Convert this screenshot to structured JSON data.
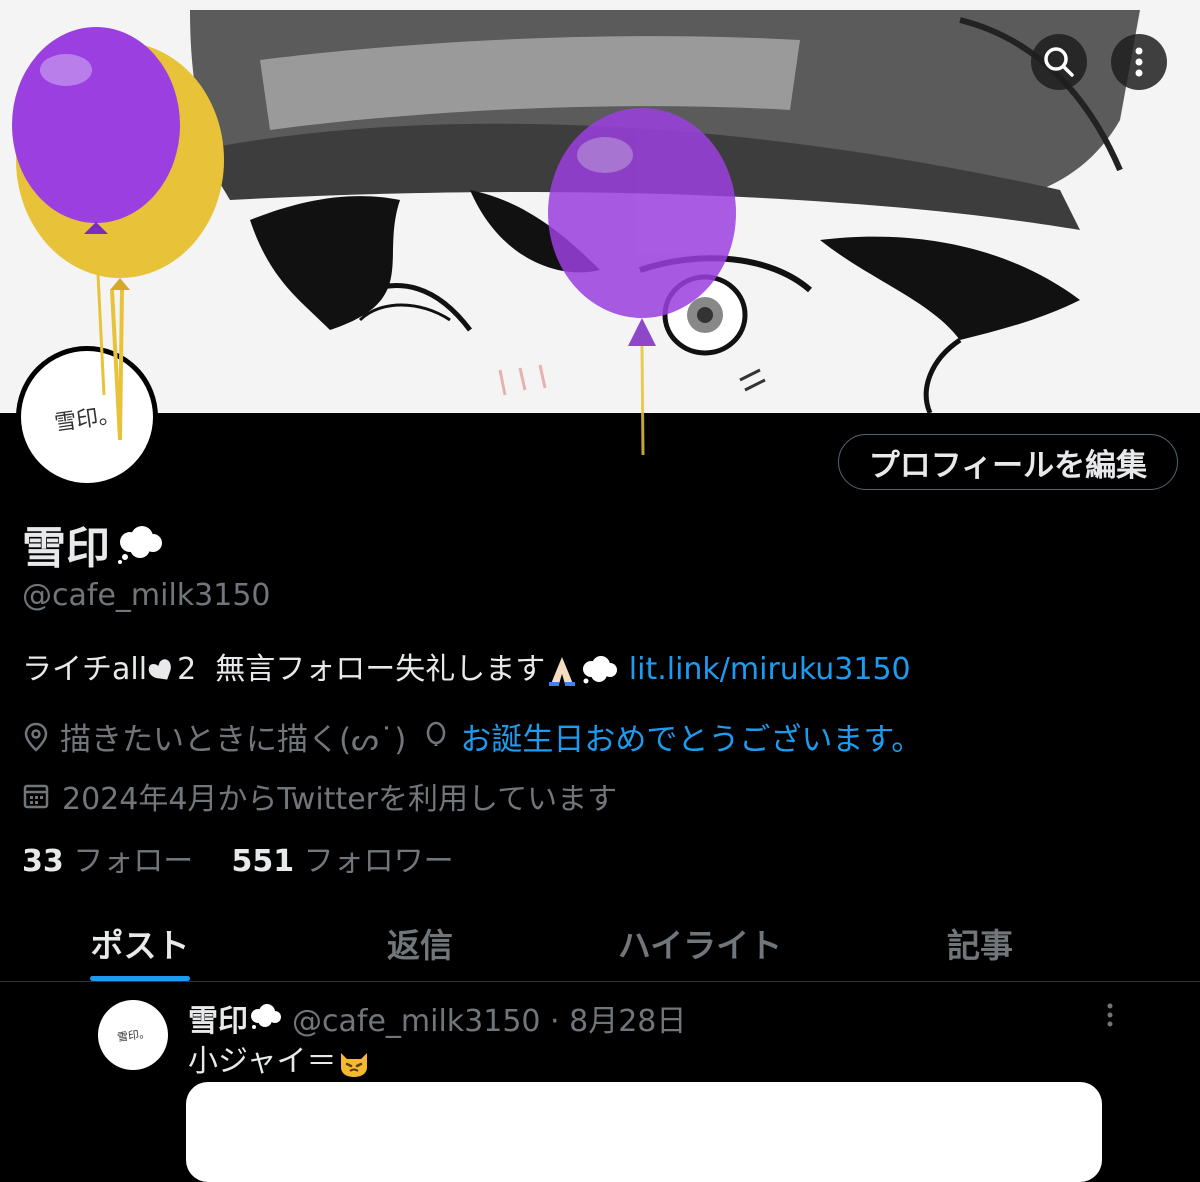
{
  "profile": {
    "display_name": "雪印",
    "handle": "@cafe_milk3150",
    "avatar_text": "雪印。",
    "bio_text": "ライチall",
    "bio_num": "2",
    "bio_text2": "無言フォロー失礼します",
    "bio_link": "lit.link/miruku3150",
    "location": "描きたいときに描く(ᔕ˙)",
    "birthday": "お誕生日おめでとうございます。",
    "joined": "2024年4月からTwitterを利用しています",
    "following_count": "33",
    "following_label": "フォロー",
    "followers_count": "551",
    "followers_label": "フォロワー",
    "edit_button": "プロフィールを編集"
  },
  "tabs": [
    {
      "label": "ポスト",
      "active": true
    },
    {
      "label": "返信",
      "active": false
    },
    {
      "label": "ハイライト",
      "active": false
    },
    {
      "label": "記事",
      "active": false
    }
  ],
  "post": {
    "name": "雪印",
    "meta": "@cafe_milk3150 · 8月28日",
    "avatar_text": "雪印。",
    "text": "小ジャイ＝"
  },
  "icons": {
    "search": "search-icon",
    "more": "more-vertical-icon",
    "location": "location-pin-icon",
    "balloon": "balloon-icon",
    "calendar": "calendar-icon",
    "thought": "thought-bubble-emoji",
    "cat": "cat-emoji",
    "pray": "praying-hands-emoji",
    "heart": "heart-emoji"
  },
  "colors": {
    "accent": "#1d9bf0",
    "background": "#000000",
    "muted": "#71767b",
    "text": "#e7e9ea",
    "balloon_purple": "#9b3fe0",
    "balloon_gold": "#e8c33a"
  }
}
